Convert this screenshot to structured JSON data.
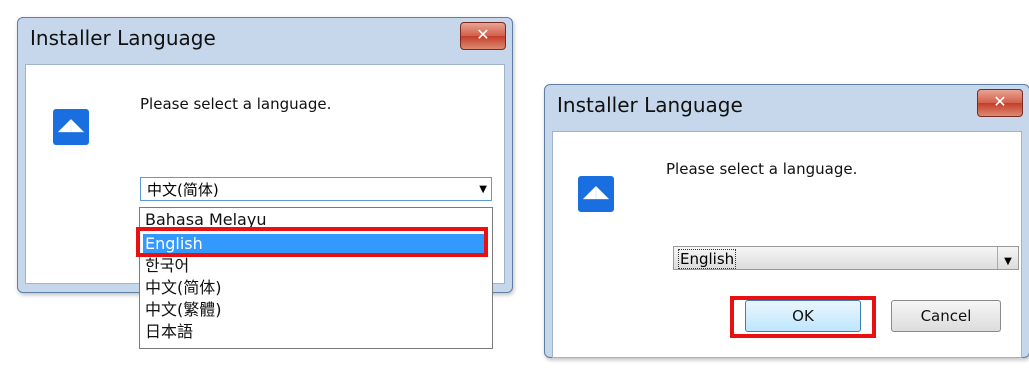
{
  "dialog_left": {
    "title": "Installer Language",
    "close_label": "✕",
    "prompt": "Please select a language.",
    "select_value": "中文(简体)",
    "options": [
      "Bahasa Melayu",
      "English",
      "한국어",
      "中文(简体)",
      "中文(繁體)",
      "日本語"
    ],
    "highlighted_option": "English"
  },
  "dialog_right": {
    "title": "Installer Language",
    "close_label": "✕",
    "prompt": "Please select a language.",
    "select_value": "English",
    "ok_label": "OK",
    "cancel_label": "Cancel"
  },
  "colors": {
    "highlight_box": "#e81010",
    "selection": "#3399ff",
    "app_icon": "#1a6fe0"
  }
}
